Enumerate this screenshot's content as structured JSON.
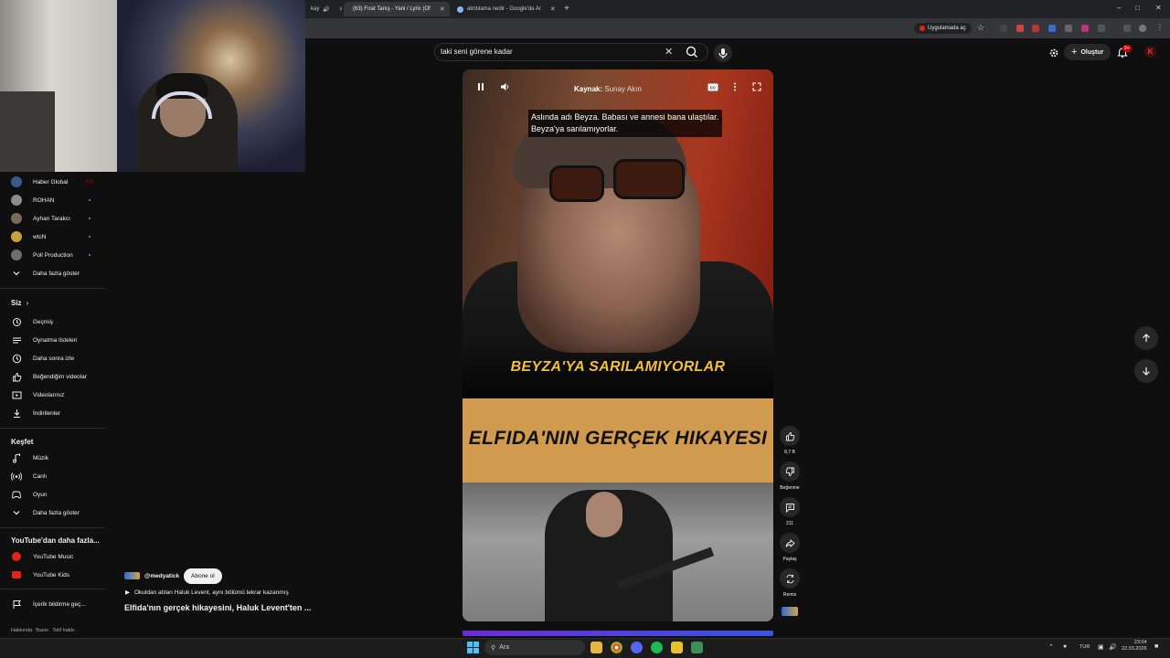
{
  "browser": {
    "tabs": [
      {
        "title": "kay"
      },
      {
        "title": "(63) Fırat Tanış - Yani / Lyric (Of"
      },
      {
        "title": "alıntılama nedir - Google'da Ar"
      }
    ],
    "open_app_label": "Uygulamada aç",
    "new_tab": "+"
  },
  "header": {
    "search_query": "taki seni görene kadar",
    "create_label": "Oluştur",
    "notification_count": "9+"
  },
  "sidebar": {
    "subscriptions": [
      {
        "name": "Haber Global",
        "avatar_color": "#3b5a8c",
        "live": true
      },
      {
        "name": "ROHAN",
        "avatar_color": "#8d8d8d",
        "live": false
      },
      {
        "name": "Ayhan Tarakcı",
        "avatar_color": "#7a6a5a",
        "live": false
      },
      {
        "name": "wtcN",
        "avatar_color": "#c9a13a",
        "live": false
      },
      {
        "name": "Poll Production",
        "avatar_color": "#6e6e6e",
        "live": false
      }
    ],
    "show_more_subs": "Daha fazla göster",
    "you_heading": "Siz",
    "you_items": [
      "Geçmiş",
      "Oynatma listeleri",
      "Daha sonra izle",
      "Beğendiğim videolar",
      "Videolarınız",
      "İndirilenler"
    ],
    "explore_heading": "Keşfet",
    "explore_items": [
      "Müzik",
      "Canlı",
      "Oyun"
    ],
    "show_more_explore": "Daha fazla göster",
    "more_heading": "YouTube'dan daha fazla...",
    "more_items": [
      "YouTube Music",
      "YouTube Kids"
    ],
    "report_history": "İçerik bildirme geç...",
    "footer_links": [
      "Hakkında",
      "Basın",
      "Telif hakkı"
    ]
  },
  "video": {
    "source_label": "Kaynak:",
    "source_name": "Sunay Akın",
    "subtitle": "Aslında adı Beyza. Babası ve annesi bana ulaştılar. Beyza'ya sarılamıyorlar.",
    "caption_1": "BEYZA'YA SARILAMIYORLAR",
    "caption_2": "ELFIDA'NIN GERÇEK HIKAYESI"
  },
  "actions": {
    "like_count": "8,7 B",
    "dislike_label": "Beğenme",
    "comment_count": "211",
    "share_label": "Paylaş",
    "remix_label": "Remix"
  },
  "channel": {
    "handle": "@medyatick",
    "subscribe_label": "Abone ol",
    "playlist_line": "Okuldan atılan Haluk Levent, aynı bölümü tekrar kazanmış",
    "video_title": "Elfida'nın gerçek hikayesini, Haluk Levent'ten ..."
  },
  "taskbar": {
    "search_placeholder": "Ara",
    "lang": "TUR",
    "time": "23:04",
    "date": "22.03.2026"
  },
  "colors": {
    "yt_red": "#ff0000",
    "bg": "#0f0f0f",
    "caption_yellow": "#f2c230",
    "orange_band": "#d09a4f"
  }
}
